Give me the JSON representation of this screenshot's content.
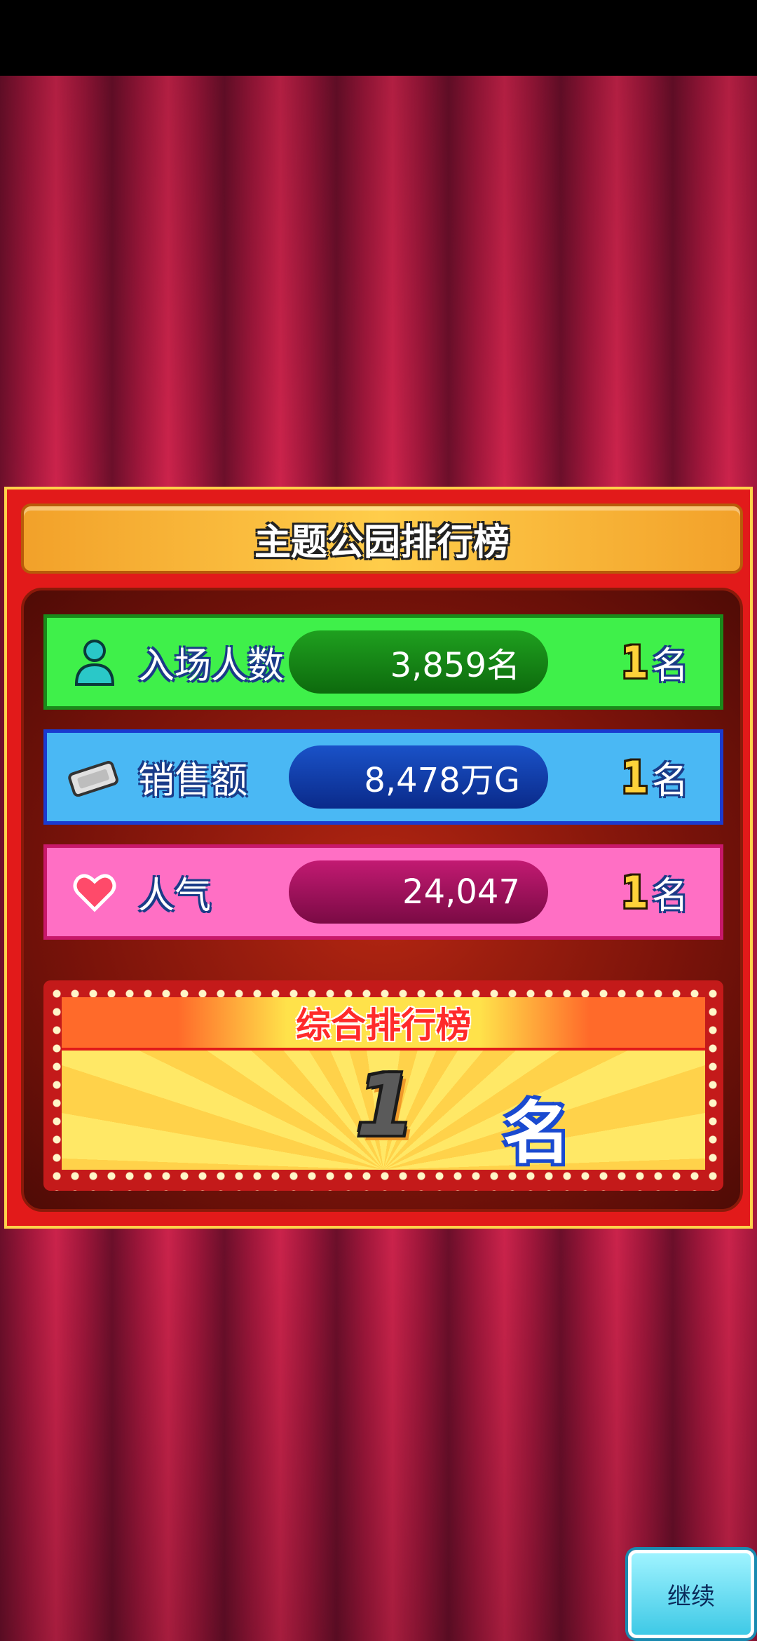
{
  "panel": {
    "title": "主题公园排行榜"
  },
  "rows": [
    {
      "icon": "person-icon",
      "label": "入场人数",
      "value": "3,859名",
      "rank": "1",
      "rank_unit": "名"
    },
    {
      "icon": "money-icon",
      "label": "销售额",
      "value": "8,478万G",
      "rank": "1",
      "rank_unit": "名"
    },
    {
      "icon": "heart-icon",
      "label": "人气",
      "value": "24,047",
      "rank": "1",
      "rank_unit": "名"
    }
  ],
  "overall": {
    "title": "综合排行榜",
    "rank": "1",
    "rank_unit": "名"
  },
  "continue_button": {
    "label": "继续"
  },
  "colors": {
    "green_row": "#3ff04a",
    "blue_row": "#4ab8f4",
    "pink_row": "#ff6fc4",
    "curtain": "#a3173c",
    "panel": "#e21a1a"
  }
}
